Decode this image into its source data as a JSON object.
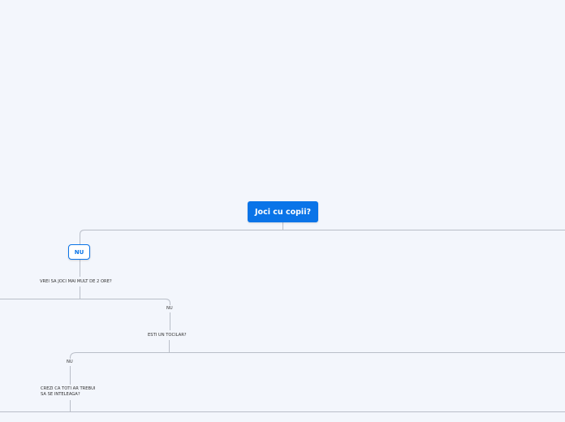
{
  "mindmap": {
    "root": "Joci cu copii?",
    "branch_no": "NU",
    "q1": "VREI SA JOCI MAI MULT DE 2 ORE?",
    "q1_no": "NU",
    "q2": "ESTI UN TOCILAR?",
    "q2_no": "NU",
    "q3_line1": "CREZI CA TOTI AR TREBUI",
    "q3_line2": "SA SE INTELEAGA?"
  },
  "colors": {
    "background": "#f3f6fc",
    "accent": "#0a74e8",
    "connector": "#b9bec8",
    "text": "#333333"
  }
}
